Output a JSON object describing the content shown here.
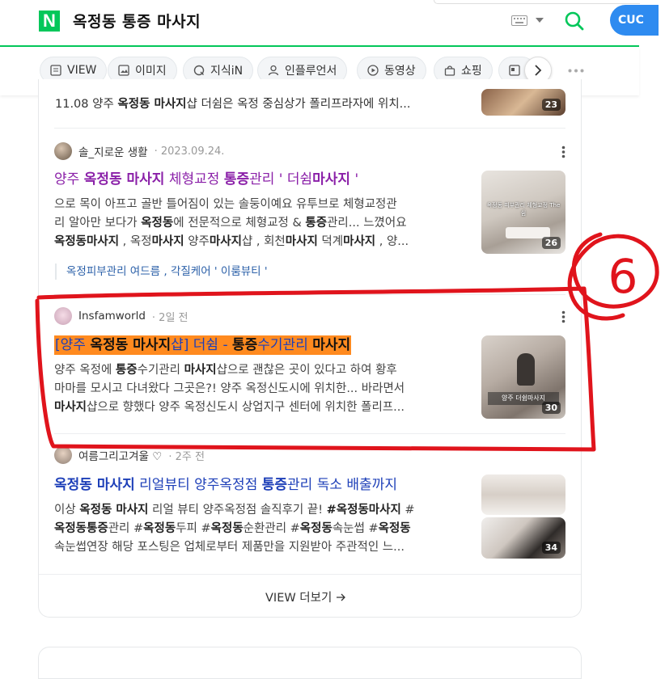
{
  "header": {
    "logo": "N",
    "query": "옥정동 통증 마사지",
    "search_button": "CUC"
  },
  "tabs": [
    {
      "label": "VIEW",
      "icon": "document-icon"
    },
    {
      "label": "이미지",
      "icon": "image-icon"
    },
    {
      "label": "지식iN",
      "icon": "q-icon"
    },
    {
      "label": "인플루언서",
      "icon": "person-icon"
    },
    {
      "label": "동영상",
      "icon": "play-icon"
    },
    {
      "label": "쇼핑",
      "icon": "bag-icon"
    }
  ],
  "previous_snippet": {
    "pre": "11.08 양주 ",
    "b1": "옥정동 마사지",
    "post": "샵 더쉼은 옥정 중심상가 폴리프라자에 위치...",
    "thumb_count": "23"
  },
  "post1": {
    "author": "솔_지로운 생활",
    "date": "· 2023.09.24.",
    "title": {
      "t1": "양주 ",
      "t2": "옥정동 마사지",
      "t3": " 체형교정 ",
      "t4": "통증",
      "t5": "관리 ' 더쉼",
      "t6": "마사지",
      "t7": " '"
    },
    "line1": "으로 목이 아프고 골반 틀어짐이 있는 솔둥이예요 유투브로 체형교정관",
    "line2": {
      "a": "리 알아만 보다가 ",
      "b": "옥정동",
      "c": "에 전문적으로 체형교정 & ",
      "d": "통증",
      "e": "관리... 느꼈어요"
    },
    "line3": {
      "a": "옥정동마사지",
      "b": " , 옥정",
      "c": "마사지",
      "d": " 양주",
      "e": "마사지",
      "f": "샵 , 회천",
      "g": "마사지",
      "h": " 덕계",
      "i": "마사지",
      "j": " , 양..."
    },
    "tags": "옥정피부관리 여드름 , 각질케어 ' 이룸뷰티 '",
    "thumb_count": "26",
    "thumb_caption": "옥정동 피부관리 체형교정 The 쉼"
  },
  "post2": {
    "author": "Insfamworld",
    "date": "· 2일 전",
    "title": {
      "t1": "[양주 ",
      "t2": "옥정동 마사지",
      "t3": "샵] 더쉼 - ",
      "t4": "통증",
      "t5": "수기관리 ",
      "t6": "마사지"
    },
    "line1": {
      "a": "양주 옥정에 ",
      "b": "통증",
      "c": "수기관리 ",
      "d": "마사지",
      "e": "샵으로 괜찮은 곳이 있다고 하여 황후"
    },
    "line2": "마마를 모시고 다녀왔다 그곳은?! 양주 옥정신도시에 위치한... 바라면서",
    "line3": {
      "a": "마사지",
      "b": "샵으로 향했다 양주 옥정신도시 상업지구 센터에 위치한 폴리프..."
    },
    "thumb_count": "30",
    "thumb_caption": "양주 더쉼마사지"
  },
  "post3": {
    "author": "여름그리고겨울 ♡",
    "date": "· 2주 전",
    "title": {
      "t1": "옥정동 마사지",
      "t2": " 리얼뷰티 양주옥정점 ",
      "t3": "통증",
      "t4": "관리 독소 배출까지"
    },
    "line1": {
      "a": "이상 ",
      "b": "옥정동 마사지",
      "c": " 리얼 뷰티 양주옥정점 솔직후기 끝! ",
      "d": "#옥정동마사지",
      "e": " #"
    },
    "line2": {
      "a": "옥정동통증",
      "b": "관리 #",
      "c": "옥정동",
      "d": "두피 #",
      "e": "옥정동",
      "f": "순환관리 #",
      "g": "옥정동",
      "h": "속눈썹 #",
      "i": "옥정동"
    },
    "line3": "속눈썹연장 해당 포스팅은 업체로부터 제품만을 지원받아 주관적인 느...",
    "thumb_count": "34"
  },
  "more_label": "VIEW 더보기",
  "annotation_number": "6",
  "colors": {
    "naver_green": "#03c75a",
    "link_blue": "#1d3fb8",
    "visited_purple": "#8a1fa8",
    "highlight_orange": "#ff8a1f",
    "annotation_red": "#e0141c"
  }
}
